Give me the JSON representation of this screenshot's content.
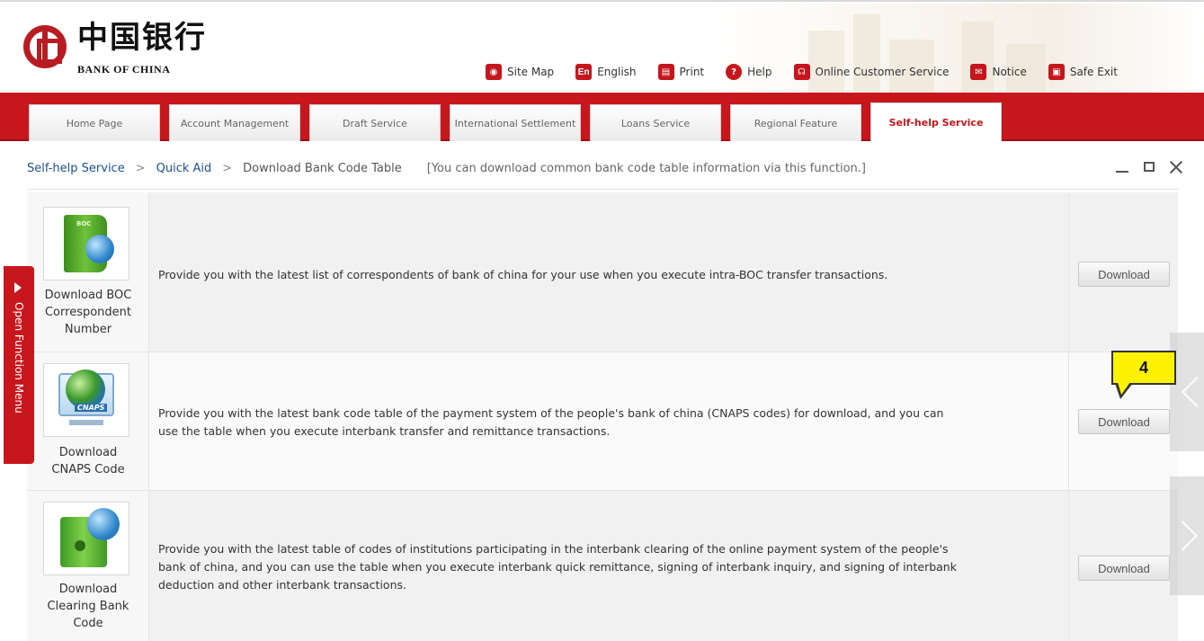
{
  "header": {
    "logo_cn": "中国银行",
    "logo_en": "BANK OF CHINA",
    "links": [
      {
        "icon": "site-map-icon",
        "label": "Site Map"
      },
      {
        "icon": "english-icon",
        "label": "English",
        "badge": "En"
      },
      {
        "icon": "print-icon",
        "label": "Print"
      },
      {
        "icon": "help-icon",
        "label": "Help"
      },
      {
        "icon": "customer-service-icon",
        "label": "Online Customer Service"
      },
      {
        "icon": "notice-icon",
        "label": "Notice"
      },
      {
        "icon": "lock-icon",
        "label": "Safe Exit"
      }
    ]
  },
  "nav": {
    "tabs": [
      {
        "label": "Home Page",
        "active": false
      },
      {
        "label": "Account Management",
        "active": false
      },
      {
        "label": "Draft Service",
        "active": false
      },
      {
        "label": "International Settlement",
        "active": false
      },
      {
        "label": "Loans Service",
        "active": false
      },
      {
        "label": "Regional Feature",
        "active": false
      },
      {
        "label": "Self-help Service",
        "active": true
      }
    ]
  },
  "breadcrumb": {
    "items": [
      "Self-help Service",
      "Quick Aid",
      "Download Bank Code Table"
    ],
    "separator": ">",
    "hint": "[You can download common bank code table information via this function.]"
  },
  "side_menu": {
    "label": "Open Function Menu"
  },
  "rows": [
    {
      "icon": "boc-book-globe-icon",
      "label_lines": [
        "Download BOC",
        "Correspondent",
        "Number"
      ],
      "description_lines": [
        "Provide you with the latest list of correspondents of bank of china for your use when you execute intra-BOC transfer transactions."
      ],
      "button": "Download"
    },
    {
      "icon": "cnaps-monitor-globe-icon",
      "label_lines": [
        "Download",
        "CNAPS Code"
      ],
      "description_lines": [
        "Provide you with the latest bank code table of the payment system of the people's bank of china (CNAPS codes) for download, and you can",
        "use the table when you execute interbank transfer and remittance transactions."
      ],
      "button": "Download",
      "icon_tag": "CNAPS"
    },
    {
      "icon": "safe-globe-icon",
      "label_lines": [
        "Download",
        "Clearing Bank",
        "Code"
      ],
      "description_lines": [
        "Provide you with the latest table of codes of institutions participating in the interbank clearing of the online payment system of the people's",
        "bank of china, and you can use the table when you execute interbank quick remittance, signing of interbank inquiry, and signing of interbank",
        "deduction and other interbank transactions."
      ],
      "button": "Download"
    }
  ],
  "callout": {
    "label": "4"
  },
  "colors": {
    "brand_red": "#c8161d",
    "link_blue": "#1d4f91",
    "callout_yellow": "#fff200"
  }
}
